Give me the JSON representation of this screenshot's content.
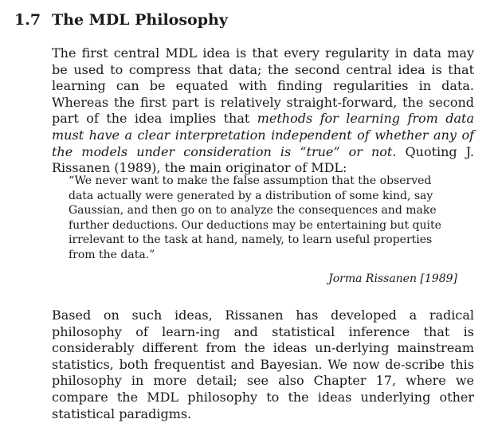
{
  "section": {
    "number": "1.7",
    "title": "The MDL Philosophy"
  },
  "para1": {
    "text_1": "The first central MDL idea is that every regularity in data may be used to compress that data; the second central idea is that learning can be equated with finding regularities in data. Whereas the first part is relatively straight-forward, the second part of the idea implies that ",
    "emph": "methods for learning from data must have a clear interpretation independent of whether any of the models under consideration is “true” or not.",
    "text_2": " Quoting J. Rissanen (1989), the main originator of MDL:"
  },
  "quote": {
    "text": "“We never want to make the false assumption that the observed data actually were generated by a distribution of some kind, say Gaussian, and then go on to analyze the consequences and make further deductions. Our deductions may be entertaining but quite irrelevant to the task at hand, namely, to learn useful properties from the data.”",
    "attribution": "Jorma Rissanen [1989]"
  },
  "para2": {
    "text": "Based on such ideas, Rissanen has developed a radical philosophy of learn-ing and statistical inference that is considerably different from the ideas un-derlying mainstream statistics, both frequentist and Bayesian. We now de-scribe this philosophy in more detail; see also Chapter 17, where we compare the MDL philosophy to the ideas underlying other statistical paradigms."
  }
}
